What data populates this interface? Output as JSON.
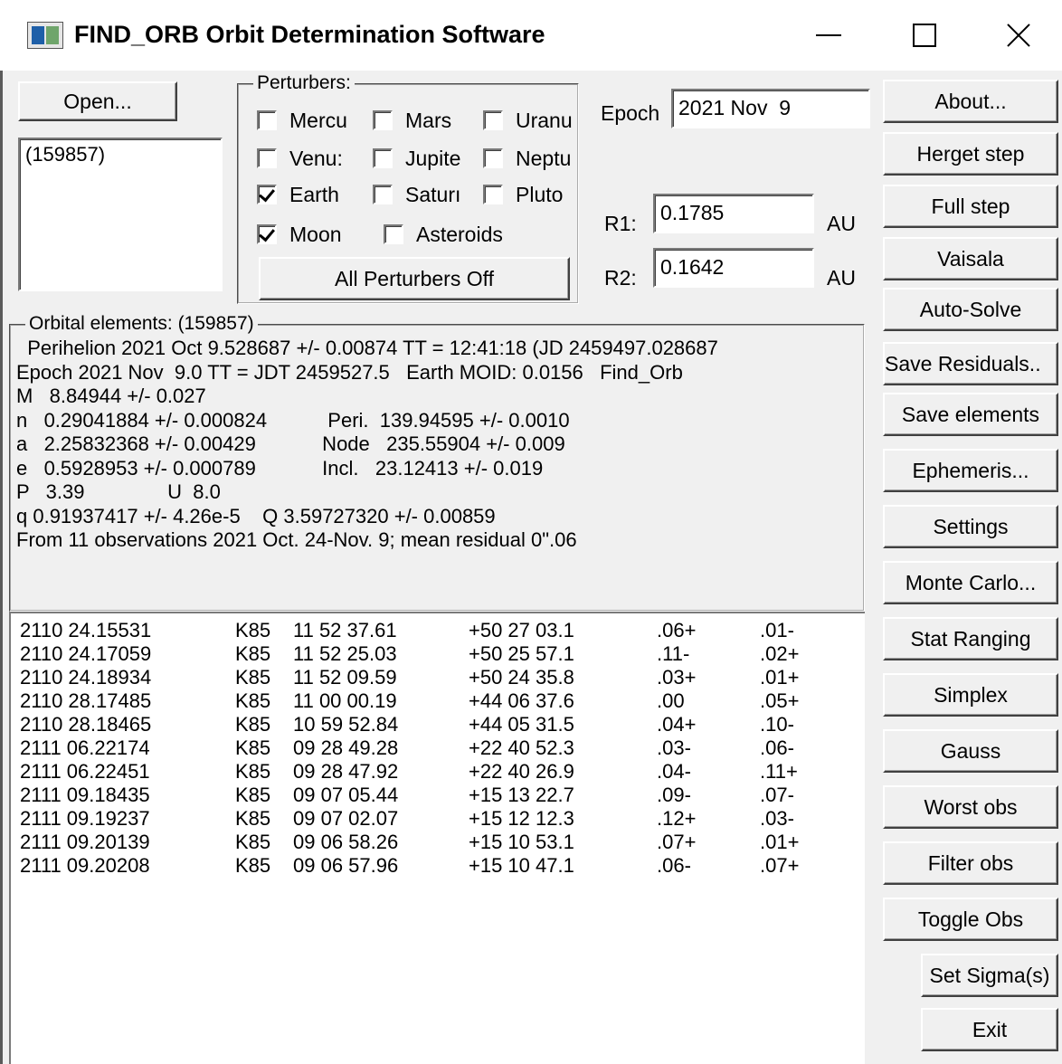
{
  "window": {
    "title": "FIND_ORB Orbit Determination Software",
    "icon": "app-window-icon"
  },
  "open_button": "Open...",
  "object_list": [
    "(159857)"
  ],
  "perturbers": {
    "legend": "Perturbers:",
    "items": [
      {
        "label": "Mercu",
        "checked": false
      },
      {
        "label": "Mars",
        "checked": false
      },
      {
        "label": "Uranu",
        "checked": false
      },
      {
        "label": "Venu:",
        "checked": false
      },
      {
        "label": "Jupite",
        "checked": false
      },
      {
        "label": "Neptu",
        "checked": false
      },
      {
        "label": "Earth",
        "checked": true
      },
      {
        "label": "Saturı",
        "checked": false
      },
      {
        "label": "Pluto",
        "checked": false
      },
      {
        "label": "Moon",
        "checked": true
      },
      {
        "label": "Asteroids",
        "checked": false
      }
    ],
    "all_off_label": "All Perturbers Off"
  },
  "epoch": {
    "label": "Epoch",
    "value": "2021 Nov  9"
  },
  "r1": {
    "label": "R1:",
    "value": "0.1785",
    "unit": "AU"
  },
  "r2": {
    "label": "R2:",
    "value": "0.1642",
    "unit": "AU"
  },
  "orbital_elements": {
    "legend": "Orbital elements:  (159857)",
    "lines": [
      "  Perihelion 2021 Oct 9.528687 +/- 0.00874 TT = 12:41:18 (JD 2459497.028687",
      "Epoch 2021 Nov  9.0 TT = JDT 2459527.5   Earth MOID: 0.0156   Find_Orb",
      "M   8.84944 +/- 0.027",
      "n   0.29041884 +/- 0.000824           Peri.  139.94595 +/- 0.0010",
      "a   2.25832368 +/- 0.00429            Node   235.55904 +/- 0.009",
      "e   0.5928953 +/- 0.000789            Incl.   23.12413 +/- 0.019",
      "P   3.39               U  8.0",
      "q 0.91937417 +/- 4.26e-5    Q 3.59727320 +/- 0.00859",
      "From 11 observations 2021 Oct. 24-Nov. 9; mean residual 0\".06"
    ]
  },
  "observations": [
    {
      "date": "2110 24.15531",
      "code": "K85",
      "ra": "11 52 37.61",
      "dec": "+50 27 03.1",
      "res_ra": ".06+",
      "res_dec": ".01-"
    },
    {
      "date": "2110 24.17059",
      "code": "K85",
      "ra": "11 52 25.03",
      "dec": "+50 25 57.1",
      "res_ra": ".11-",
      "res_dec": ".02+"
    },
    {
      "date": "2110 24.18934",
      "code": "K85",
      "ra": "11 52 09.59",
      "dec": "+50 24 35.8",
      "res_ra": ".03+",
      "res_dec": ".01+"
    },
    {
      "date": "2110 28.17485",
      "code": "K85",
      "ra": "11 00 00.19",
      "dec": "+44 06 37.6",
      "res_ra": ".00",
      "res_dec": ".05+"
    },
    {
      "date": "2110 28.18465",
      "code": "K85",
      "ra": "10 59 52.84",
      "dec": "+44 05 31.5",
      "res_ra": ".04+",
      "res_dec": ".10-"
    },
    {
      "date": "2111 06.22174",
      "code": "K85",
      "ra": "09 28 49.28",
      "dec": "+22 40 52.3",
      "res_ra": ".03-",
      "res_dec": ".06-"
    },
    {
      "date": "2111 06.22451",
      "code": "K85",
      "ra": "09 28 47.92",
      "dec": "+22 40 26.9",
      "res_ra": ".04-",
      "res_dec": ".11+"
    },
    {
      "date": "2111 09.18435",
      "code": "K85",
      "ra": "09 07 05.44",
      "dec": "+15 13 22.7",
      "res_ra": ".09-",
      "res_dec": ".07-"
    },
    {
      "date": "2111 09.19237",
      "code": "K85",
      "ra": "09 07 02.07",
      "dec": "+15 12 12.3",
      "res_ra": ".12+",
      "res_dec": ".03-"
    },
    {
      "date": "2111 09.20139",
      "code": "K85",
      "ra": "09 06 58.26",
      "dec": "+15 10 53.1",
      "res_ra": ".07+",
      "res_dec": ".01+"
    },
    {
      "date": "2111 09.20208",
      "code": "K85",
      "ra": "09 06 57.96",
      "dec": "+15 10 47.1",
      "res_ra": ".06-",
      "res_dec": ".07+"
    }
  ],
  "commands": [
    "About...",
    "Herget step",
    "Full step",
    "Vaisala",
    "Auto-Solve",
    "Save Residuals..",
    "Save elements",
    "Ephemeris...",
    "Settings",
    "Monte Carlo...",
    "Stat Ranging",
    "Simplex",
    "Gauss",
    "Worst obs",
    "Filter obs",
    "Toggle Obs",
    "Set Sigma(s)",
    "Exit"
  ]
}
